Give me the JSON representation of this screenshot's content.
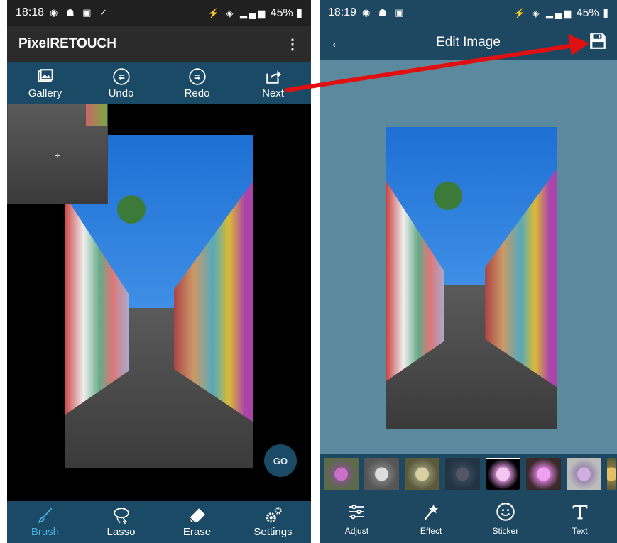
{
  "left": {
    "status": {
      "time": "18:18",
      "battery": "45%"
    },
    "app_title": "PixelRETOUCH",
    "toolbar": [
      {
        "label": "Gallery",
        "icon": "gallery-icon"
      },
      {
        "label": "Undo",
        "icon": "undo-icon"
      },
      {
        "label": "Redo",
        "icon": "redo-icon"
      },
      {
        "label": "Next",
        "icon": "share-icon"
      }
    ],
    "go_label": "GO",
    "bottom_tools": [
      {
        "label": "Brush",
        "icon": "brush-icon",
        "active": true
      },
      {
        "label": "Lasso",
        "icon": "lasso-icon"
      },
      {
        "label": "Erase",
        "icon": "eraser-icon"
      },
      {
        "label": "Settings",
        "icon": "gears-icon"
      }
    ]
  },
  "right": {
    "status": {
      "time": "18:19",
      "battery": "45%"
    },
    "title": "Edit Image",
    "edit_tools": [
      {
        "label": "Adjust",
        "icon": "sliders-icon"
      },
      {
        "label": "Effect",
        "icon": "magic-wand-icon"
      },
      {
        "label": "Sticker",
        "icon": "smiley-icon"
      },
      {
        "label": "Text",
        "icon": "text-icon"
      }
    ]
  },
  "colors": {
    "toolbar_blue": "#1a4a66",
    "active_blue": "#4ab0e6",
    "edit_background": "#5b8a9e",
    "annotation_arrow": "#e01010"
  }
}
